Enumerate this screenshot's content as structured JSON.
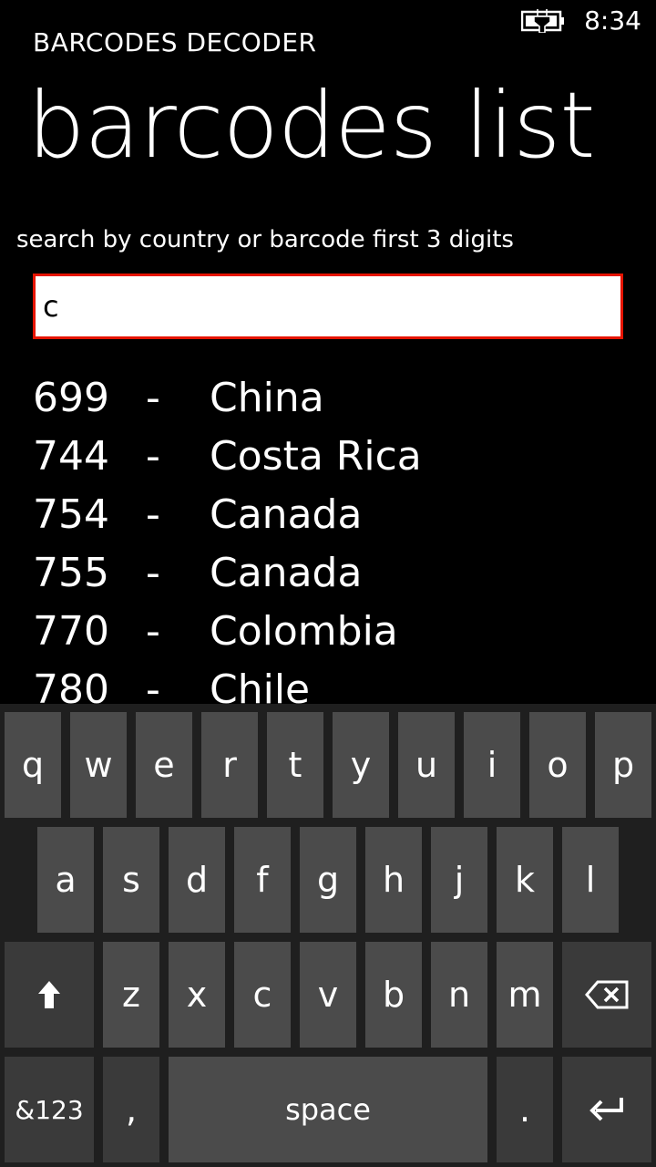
{
  "status": {
    "time": "8:34",
    "battery_icon": "battery-charging-icon"
  },
  "header": {
    "app_name": "BARCODES DECODER",
    "page_title": "barcodes list"
  },
  "search": {
    "label": "search by country or barcode first 3 digits",
    "value": "c"
  },
  "results": [
    {
      "code": "699",
      "sep": "-",
      "country": "China"
    },
    {
      "code": "744",
      "sep": "-",
      "country": "Costa Rica"
    },
    {
      "code": "754",
      "sep": "-",
      "country": "Canada"
    },
    {
      "code": "755",
      "sep": "-",
      "country": "Canada"
    },
    {
      "code": "770",
      "sep": "-",
      "country": "Colombia"
    },
    {
      "code": "780",
      "sep": "-",
      "country": "Chile"
    }
  ],
  "keyboard": {
    "row1": [
      "q",
      "w",
      "e",
      "r",
      "t",
      "y",
      "u",
      "i",
      "o",
      "p"
    ],
    "row2": [
      "a",
      "s",
      "d",
      "f",
      "g",
      "h",
      "j",
      "k",
      "l"
    ],
    "row3": [
      "z",
      "x",
      "c",
      "v",
      "b",
      "n",
      "m"
    ],
    "shift_icon": "shift-arrow-icon",
    "backspace_icon": "backspace-icon",
    "enter_icon": "enter-icon",
    "symbols_label": "&123",
    "comma_label": ",",
    "space_label": "space",
    "period_label": "."
  }
}
